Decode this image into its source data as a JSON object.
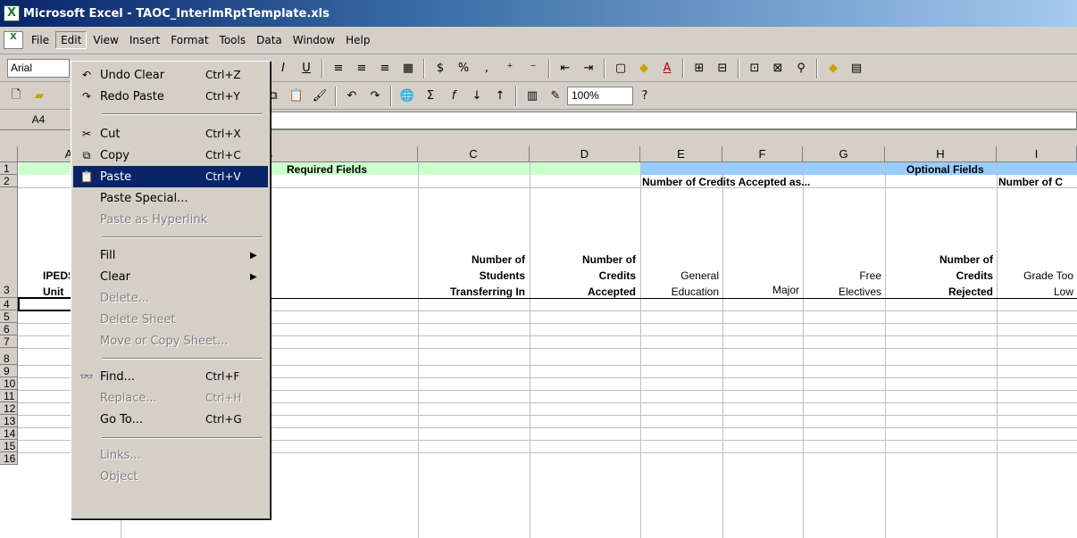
{
  "window": {
    "title": "Microsoft Excel - TAOC_InterimRptTemplate.xls"
  },
  "menubar": {
    "items": [
      "File",
      "Edit",
      "View",
      "Insert",
      "Format",
      "Tools",
      "Data",
      "Window",
      "Help"
    ]
  },
  "toolbar": {
    "font": "Arial",
    "zoom": "100%"
  },
  "formula": {
    "namebox": "A4"
  },
  "columns": [
    "A",
    "B",
    "C",
    "D",
    "E",
    "F",
    "G",
    "H",
    "I"
  ],
  "rows": [
    "1",
    "2",
    "3",
    "4",
    "5",
    "6",
    "7",
    "8",
    "9",
    "10",
    "11",
    "12",
    "13",
    "14",
    "15",
    "16"
  ],
  "cells": {
    "b1": "Required Fields",
    "h1": "Optional Fields",
    "e2": "Number of Credits Accepted as...",
    "i2": "Number of C",
    "a3": "IPEDS Unit",
    "c3_1": "Number of",
    "c3_2": "Students",
    "c3_3": "Transferring In",
    "d3_1": "Number of",
    "d3_2": "Credits",
    "d3_3": "Accepted",
    "e3_1": "General",
    "e3_2": "Education",
    "f3": "Major",
    "g3_1": "Free",
    "g3_2": "Electives",
    "h3_1": "Number of",
    "h3_2": "Credits",
    "h3_3": "Rejected",
    "i3_1": "Grade Too",
    "i3_2": "Low"
  },
  "colors": {
    "required": "#ccffcc",
    "optional": "#99ccff",
    "highlight": "#0a246a"
  },
  "editmenu": {
    "undo": {
      "label": "Undo Clear",
      "shortcut": "Ctrl+Z"
    },
    "redo": {
      "label": "Redo Paste",
      "shortcut": "Ctrl+Y"
    },
    "cut": {
      "label": "Cut",
      "shortcut": "Ctrl+X"
    },
    "copy": {
      "label": "Copy",
      "shortcut": "Ctrl+C"
    },
    "paste": {
      "label": "Paste",
      "shortcut": "Ctrl+V"
    },
    "paste_special": {
      "label": "Paste Special..."
    },
    "paste_hyperlink": {
      "label": "Paste as Hyperlink"
    },
    "fill": {
      "label": "Fill"
    },
    "clear": {
      "label": "Clear"
    },
    "delete": {
      "label": "Delete..."
    },
    "delete_sheet": {
      "label": "Delete Sheet"
    },
    "move_copy": {
      "label": "Move or Copy Sheet..."
    },
    "find": {
      "label": "Find...",
      "shortcut": "Ctrl+F"
    },
    "replace": {
      "label": "Replace...",
      "shortcut": "Ctrl+H"
    },
    "goto": {
      "label": "Go To...",
      "shortcut": "Ctrl+G"
    },
    "links": {
      "label": "Links..."
    },
    "object": {
      "label": "Object"
    }
  }
}
